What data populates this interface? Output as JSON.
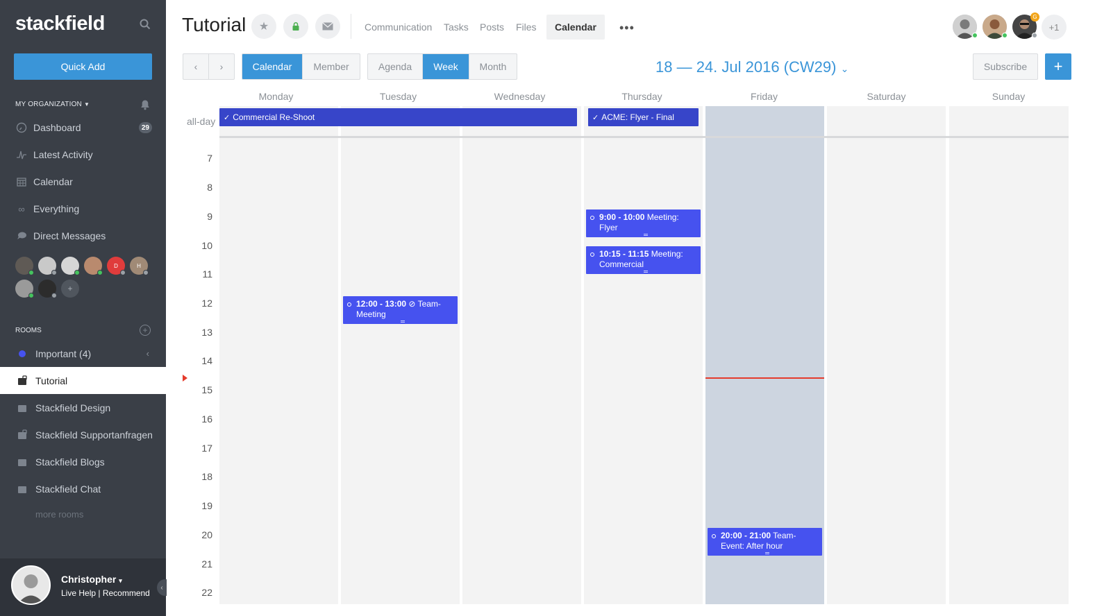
{
  "sidebar": {
    "logo": "stackfield",
    "quick_add": "Quick Add",
    "org_heading": "MY ORGANIZATION",
    "nav": [
      {
        "label": "Dashboard",
        "icon": "dashboard-icon",
        "badge": "29"
      },
      {
        "label": "Latest Activity",
        "icon": "activity-icon"
      },
      {
        "label": "Calendar",
        "icon": "calendar-icon"
      },
      {
        "label": "Everything",
        "icon": "infinity-icon"
      },
      {
        "label": "Direct Messages",
        "icon": "chat-icon"
      }
    ],
    "dm_initials": [
      "D",
      "H"
    ],
    "rooms_heading": "ROOMS",
    "rooms": [
      {
        "label": "Important (4)"
      },
      {
        "label": "Tutorial"
      },
      {
        "label": "Stackfield Design"
      },
      {
        "label": "Stackfield Supportanfragen"
      },
      {
        "label": "Stackfield Blogs"
      },
      {
        "label": "Stackfield Chat"
      }
    ],
    "more_rooms": "more rooms",
    "user": {
      "name": "Christopher",
      "links": "Live Help | Recommend"
    }
  },
  "header": {
    "title": "Tutorial",
    "tabs": [
      "Communication",
      "Tasks",
      "Posts",
      "Files",
      "Calendar"
    ],
    "active_tab": "Calendar",
    "more_members": "+1",
    "member_badge": "G"
  },
  "toolbar": {
    "view_group": [
      "Calendar",
      "Member"
    ],
    "range_group": [
      "Agenda",
      "Week",
      "Month"
    ],
    "week_title": "18 — 24. Jul 2016 (CW29)",
    "subscribe": "Subscribe",
    "add": "+"
  },
  "calendar": {
    "days": [
      "Monday",
      "Tuesday",
      "Wednesday",
      "Thursday",
      "Friday",
      "Saturday",
      "Sunday"
    ],
    "today": "Friday",
    "allday_label": "all-day",
    "hours": [
      "7",
      "8",
      "9",
      "10",
      "11",
      "12",
      "13",
      "14",
      "15",
      "16",
      "17",
      "18",
      "19",
      "20",
      "21",
      "22"
    ],
    "allday_events": [
      {
        "title": "Commercial Re-Shoot",
        "start_day": "Monday",
        "end_day": "Wednesday"
      },
      {
        "title": "ACME: Flyer - Final",
        "start_day": "Thursday",
        "end_day": "Thursday"
      }
    ],
    "events": [
      {
        "time": "9:00 - 10:00",
        "title": "Meeting: Flyer",
        "day": "Thursday",
        "start": 9,
        "end": 10
      },
      {
        "time": "10:15 - 11:15",
        "title": "Meeting: Commercial",
        "day": "Thursday",
        "start": 10.25,
        "end": 11.25
      },
      {
        "time": "12:00 - 13:00",
        "title": "Team-Meeting",
        "day": "Tuesday",
        "start": 12,
        "end": 13
      },
      {
        "time": "20:00 - 21:00",
        "title": "Team-Event: After hour",
        "day": "Friday",
        "start": 20,
        "end": 21
      }
    ],
    "colors": {
      "accent": "#3a95d8",
      "event": "#4652ef",
      "allday_event": "#3745c9",
      "now_line": "#e53b2c",
      "today_bg": "#cdd5e0"
    }
  }
}
